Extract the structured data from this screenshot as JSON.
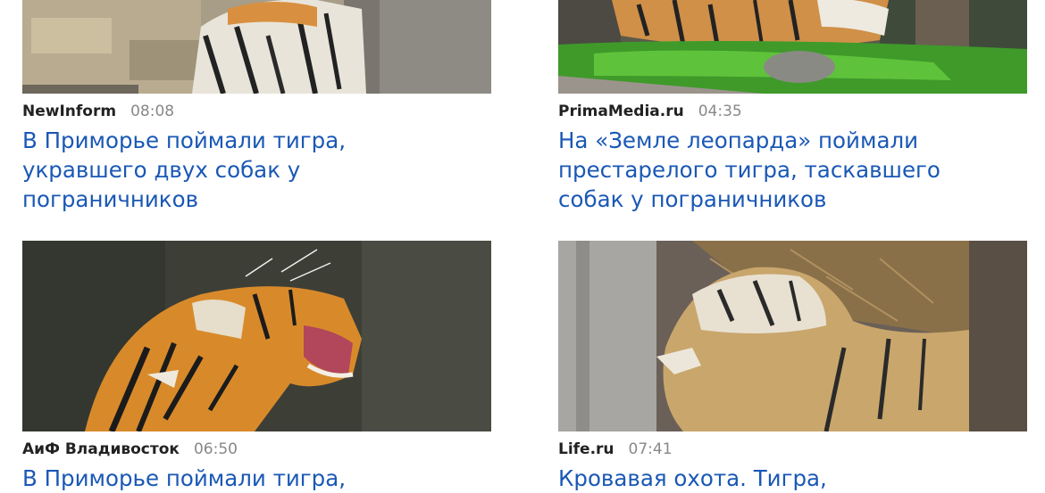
{
  "news": [
    {
      "source": "NewInform",
      "time": "08:08",
      "title_lines": [
        "В Приморье поймали тигра,",
        "укравшего двух собак у",
        "пограничников"
      ],
      "image": "tiger-on-rocks-photo"
    },
    {
      "source": "PrimaMedia.ru",
      "time": "04:35",
      "title_lines": [
        "На «Земле леопарда» поймали",
        "престарелого тигра, таскавшего",
        "собак у пограничников"
      ],
      "image": "tiger-lying-on-grass-photo"
    },
    {
      "source": "АиФ Владивосток",
      "time": "06:50",
      "title_lines": [
        "В Приморье поймали тигра,"
      ],
      "image": "roaring-tiger-photo"
    },
    {
      "source": "Life.ru",
      "time": "07:41",
      "title_lines": [
        "Кровавая охота. Тигра,"
      ],
      "image": "tiger-in-enclosure-photo"
    }
  ],
  "colors": {
    "title": "#1a58b5",
    "source": "#222222",
    "time": "#888888"
  }
}
